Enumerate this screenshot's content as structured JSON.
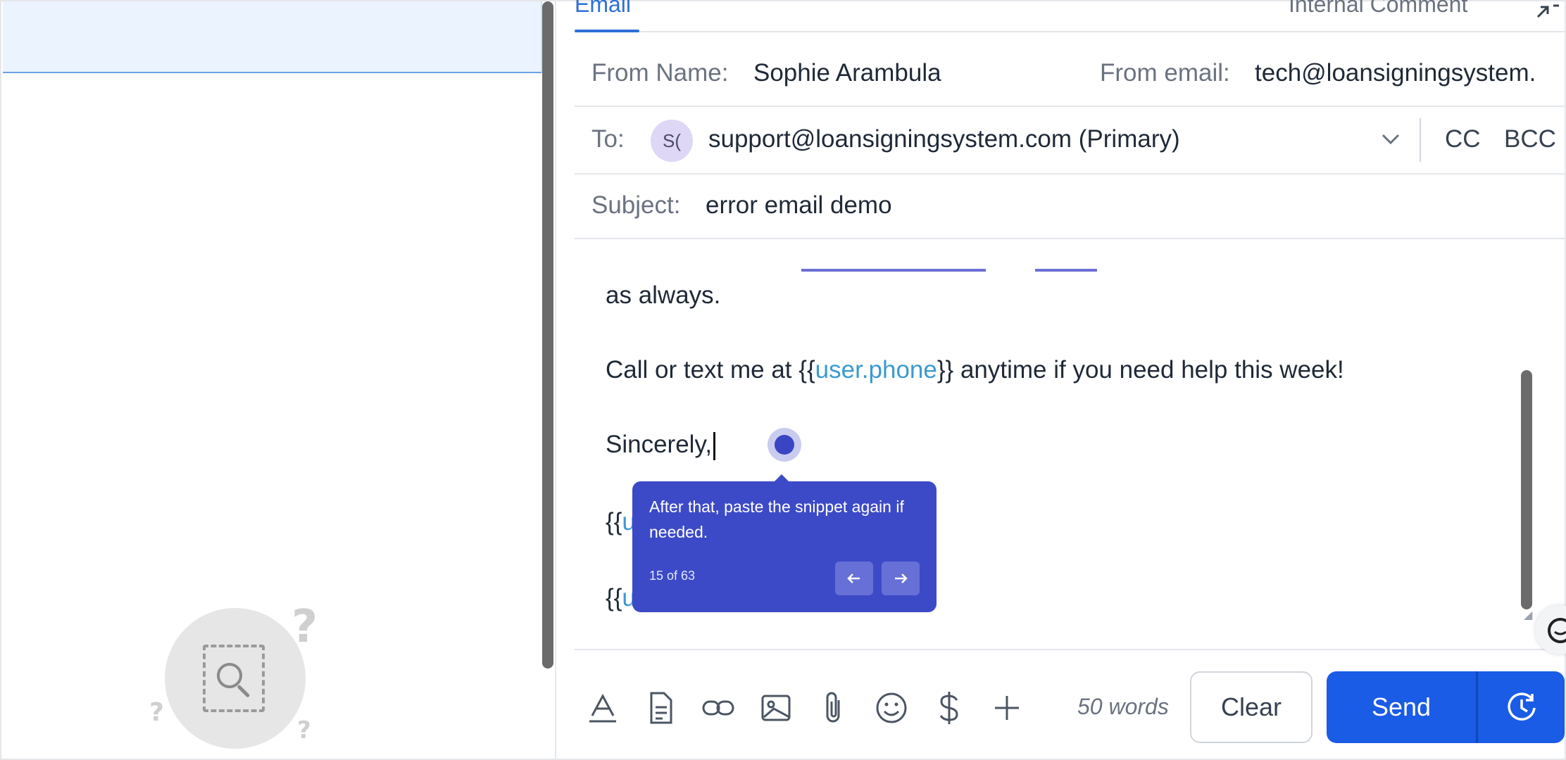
{
  "tabs": {
    "email": "Email",
    "internal_comment": "Internal Comment"
  },
  "compose": {
    "from_name_label": "From Name:",
    "from_name_value": "Sophie Arambula",
    "from_email_label": "From email:",
    "from_email_value": "tech@loansigningsystem.",
    "to_label": "To:",
    "to_avatar_initials": "S(",
    "to_value": "support@loansigningsystem.com (Primary)",
    "cc_label": "CC",
    "bcc_label": "BCC",
    "subject_label": "Subject:",
    "subject_value": "error email demo"
  },
  "body": {
    "line1": "as always.",
    "line2_prefix": "Call or text me at {{",
    "line2_var": "user.phone",
    "line2_suffix": "}} anytime if you need help this week!",
    "line3": "Sincerely,",
    "line4_prefix": "{{",
    "line4_var": "u",
    "line5_prefix": "{{",
    "line5_var": "u"
  },
  "tooltip": {
    "text": "After that, paste the snippet again if needed.",
    "counter": "15 of 63"
  },
  "toolbar": {
    "icons": [
      "text-format-icon",
      "document-icon",
      "link-icon",
      "image-icon",
      "paperclip-icon",
      "emoji-icon",
      "dollar-icon",
      "plus-icon"
    ],
    "word_count": "50 words",
    "clear_label": "Clear",
    "send_label": "Send"
  },
  "colors": {
    "accent": "#1a5ce6",
    "tooltip": "#3d4ac7",
    "variable": "#3b9ad0"
  }
}
